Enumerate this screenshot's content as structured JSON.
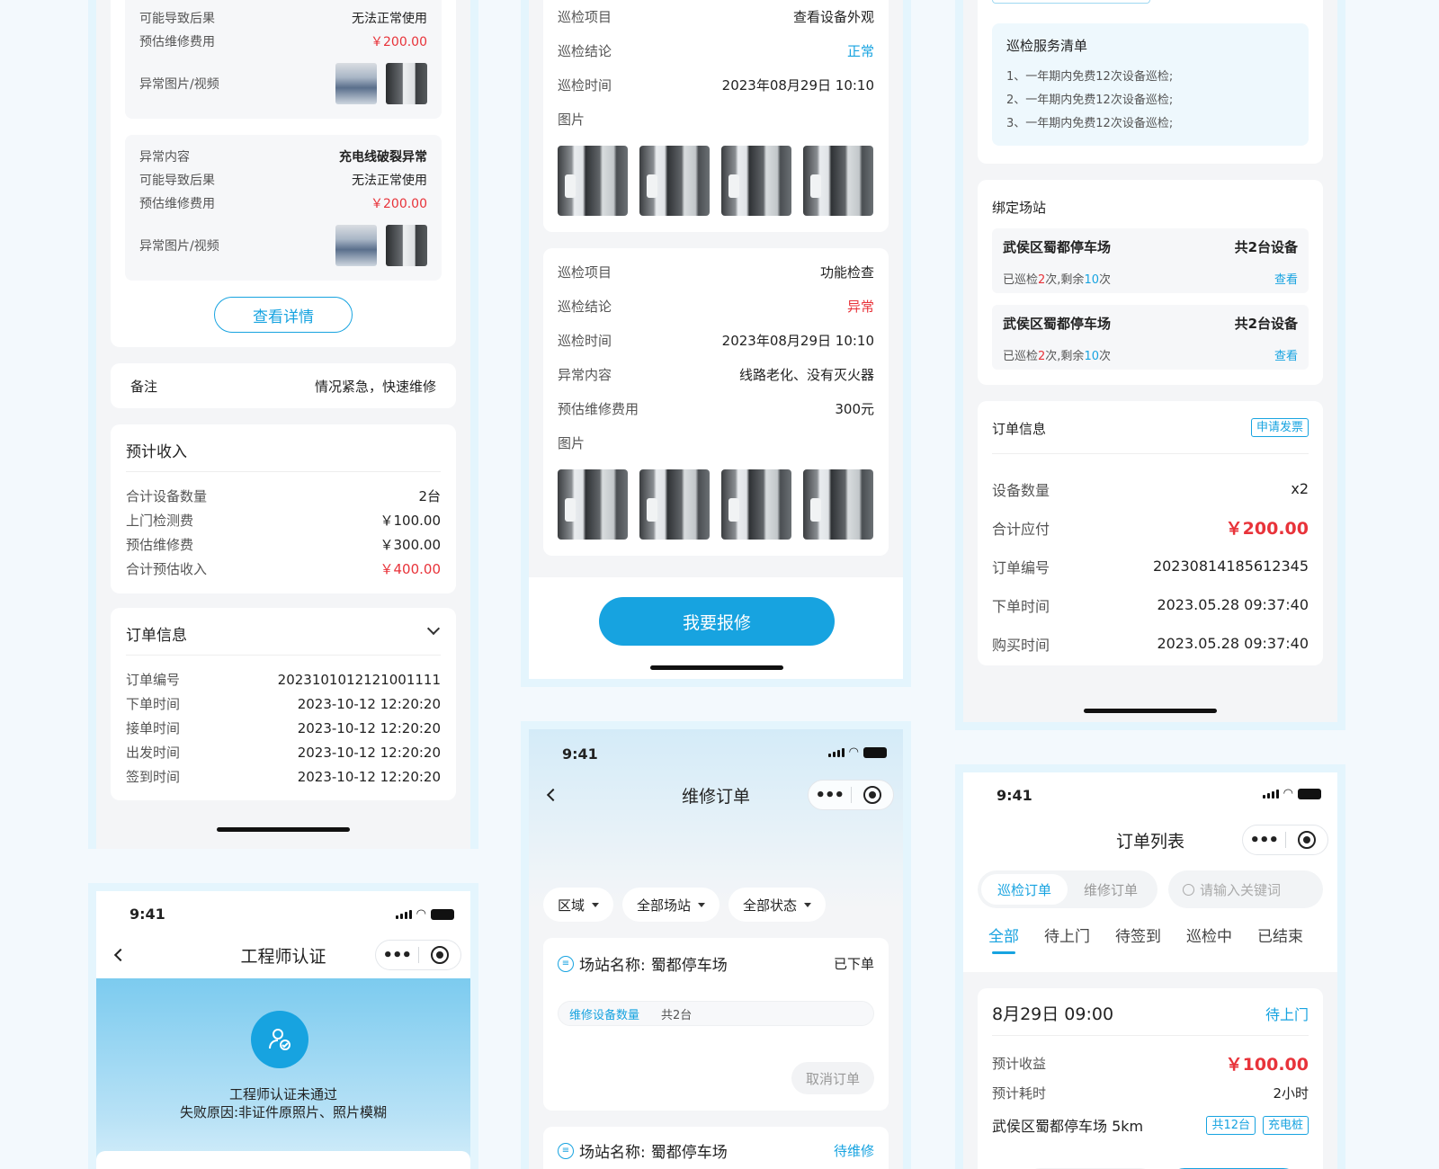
{
  "col1": {
    "abnormal_items": [
      {
        "result_label": "可能导致后果",
        "result_value": "无法正常使用",
        "cost_label": "预估维修费用",
        "cost_value": "￥200.00",
        "media_label": "异常图片/视频"
      },
      {
        "content_label": "异常内容",
        "content_value": "充电线破裂异常",
        "result_label": "可能导致后果",
        "result_value": "无法正常使用",
        "cost_label": "预估维修费用",
        "cost_value": "￥200.00",
        "media_label": "异常图片/视频"
      }
    ],
    "detail_button": "查看详情",
    "remark": {
      "label": "备注",
      "value": "情况紧急，快速维修"
    },
    "income": {
      "title": "预计收入",
      "rows": [
        {
          "label": "合计设备数量",
          "value": "2台"
        },
        {
          "label": "上门检测费",
          "value": "￥100.00"
        },
        {
          "label": "预估维修费",
          "value": "￥300.00"
        },
        {
          "label": "合计预估收入",
          "value": "￥400.00"
        }
      ]
    },
    "order": {
      "title": "订单信息",
      "rows": [
        {
          "label": "订单编号",
          "value": "2023101012121001111"
        },
        {
          "label": "下单时间",
          "value": "2023-10-12 12:20:20"
        },
        {
          "label": "接单时间",
          "value": "2023-10-12 12:20:20"
        },
        {
          "label": "出发时间",
          "value": "2023-10-12 12:20:20"
        },
        {
          "label": "签到时间",
          "value": "2023-10-12 12:20:20"
        }
      ]
    }
  },
  "cert": {
    "time": "9:41",
    "title": "工程师认证",
    "status": "工程师认证未通过",
    "reason": "失败原因:非证件原照片、照片模糊"
  },
  "inspect": {
    "card1": {
      "item_label": "巡检项目",
      "item_value": "查看设备外观",
      "result_label": "巡检结论",
      "result_value": "正常",
      "time_label": "巡检时间",
      "time_value": "2023年08月29日 10:10",
      "photo_label": "图片"
    },
    "card2": {
      "item_label": "巡检项目",
      "item_value": "功能检查",
      "result_label": "巡检结论",
      "result_value": "异常",
      "time_label": "巡检时间",
      "time_value": "2023年08月29日 10:10",
      "content_label": "异常内容",
      "content_value": "线路老化、没有灭火器",
      "cost_label": "预估维修费用",
      "cost_value": "300元",
      "photo_label": "图片"
    },
    "repair_button": "我要报修"
  },
  "repair": {
    "time": "9:41",
    "title": "维修订单",
    "filters": [
      "区域",
      "全部场站",
      "全部状态"
    ],
    "orders": [
      {
        "station_label": "场站名称:",
        "station": "蜀都停车场",
        "status": "已下单",
        "device_label": "维修设备数量",
        "device_count": "共2台",
        "cancel": "取消订单"
      },
      {
        "station_label": "场站名称:",
        "station": "蜀都停车场",
        "status": "待维修"
      }
    ]
  },
  "col3": {
    "service": {
      "title": "巡检服务清单",
      "items": [
        "1、一年期内免费12次设备巡检;",
        "2、一年期内免费12次设备巡检;",
        "3、一年期内免费12次设备巡检;"
      ]
    },
    "stations": {
      "title": "绑定场站",
      "items": [
        {
          "name": "武侯区蜀都停车场",
          "count": "共2台设备",
          "pre": "已巡检",
          "done": "2",
          "mid": "次,剩余",
          "left": "10",
          "post": "次",
          "link": "查看"
        },
        {
          "name": "武侯区蜀都停车场",
          "count": "共2台设备",
          "pre": "已巡检",
          "done": "2",
          "mid": "次,剩余",
          "left": "10",
          "post": "次",
          "link": "查看"
        }
      ]
    },
    "order": {
      "title": "订单信息",
      "invoice": "申请发票",
      "rows": [
        {
          "label": "设备数量",
          "value": "x2"
        },
        {
          "label": "合计应付",
          "value": "￥200.00"
        },
        {
          "label": "订单编号",
          "value": "20230814185612345"
        },
        {
          "label": "下单时间",
          "value": "2023.05.28  09:37:40"
        },
        {
          "label": "购买时间",
          "value": "2023.05.28  09:37:40"
        }
      ]
    }
  },
  "orders": {
    "time": "9:41",
    "title": "订单列表",
    "seg": [
      "巡检订单",
      "维修订单"
    ],
    "search_placeholder": "请输入关键词",
    "tabs": [
      "全部",
      "待上门",
      "待签到",
      "巡检中",
      "已结束"
    ],
    "card": {
      "date": "8月29日 09:00",
      "status": "待上门",
      "income_label": "预计收益",
      "income_value": "￥100.00",
      "duration_label": "预计耗时",
      "duration_value": "2小时",
      "station": "武侯区蜀都停车场 5km",
      "tags": [
        "共12台",
        "充电桩"
      ]
    }
  },
  "colors": {
    "accent": "#17a3e0",
    "danger": "#e8333a",
    "frame": "#e4f5fd"
  }
}
